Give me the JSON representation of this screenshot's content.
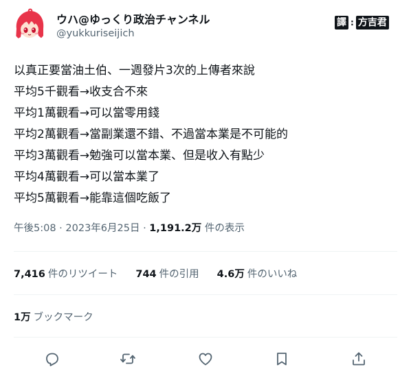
{
  "author": {
    "display_name": "ウハ@ゆっくり政治チャンネル",
    "handle": "@yukkuriseijich"
  },
  "watermark": {
    "left": "譯",
    "separator": ":",
    "right": "方吉君"
  },
  "tweet": {
    "lines": [
      "以真正要當油土伯、一週發片3次的上傳者來說",
      "平均5千觀看→收支合不來",
      "平均1萬觀看→可以當零用錢",
      "平均2萬觀看→當副業還不錯、不過當本業是不可能的",
      "平均3萬觀看→勉強可以當本業、但是收入有點少",
      "平均4萬觀看→可以當本業了",
      "平均5萬觀看→能靠這個吃飯了"
    ]
  },
  "meta": {
    "time": "午後5:08",
    "sep1": " · ",
    "date": "2023年6月25日",
    "sep2": " · ",
    "views": "1,191.2万",
    "views_label": " 件の表示"
  },
  "stats": {
    "retweets": "7,416",
    "retweets_label": "件のリツイート",
    "quotes": "744",
    "quotes_label": "件の引用",
    "likes": "4.6万",
    "likes_label": "件のいいね",
    "bookmarks": "1万",
    "bookmarks_label": "ブックマーク"
  },
  "icons": {
    "reply": "reply-icon",
    "retweet": "retweet-icon",
    "like": "heart-icon",
    "bookmark": "bookmark-icon",
    "share": "share-icon"
  },
  "colors": {
    "text": "#0f1419",
    "secondary": "#536471",
    "divider": "#eff3f4",
    "avatar_hair": "#e8344a",
    "avatar_skin": "#fde3d3",
    "avatar_eye": "#c8102e"
  }
}
